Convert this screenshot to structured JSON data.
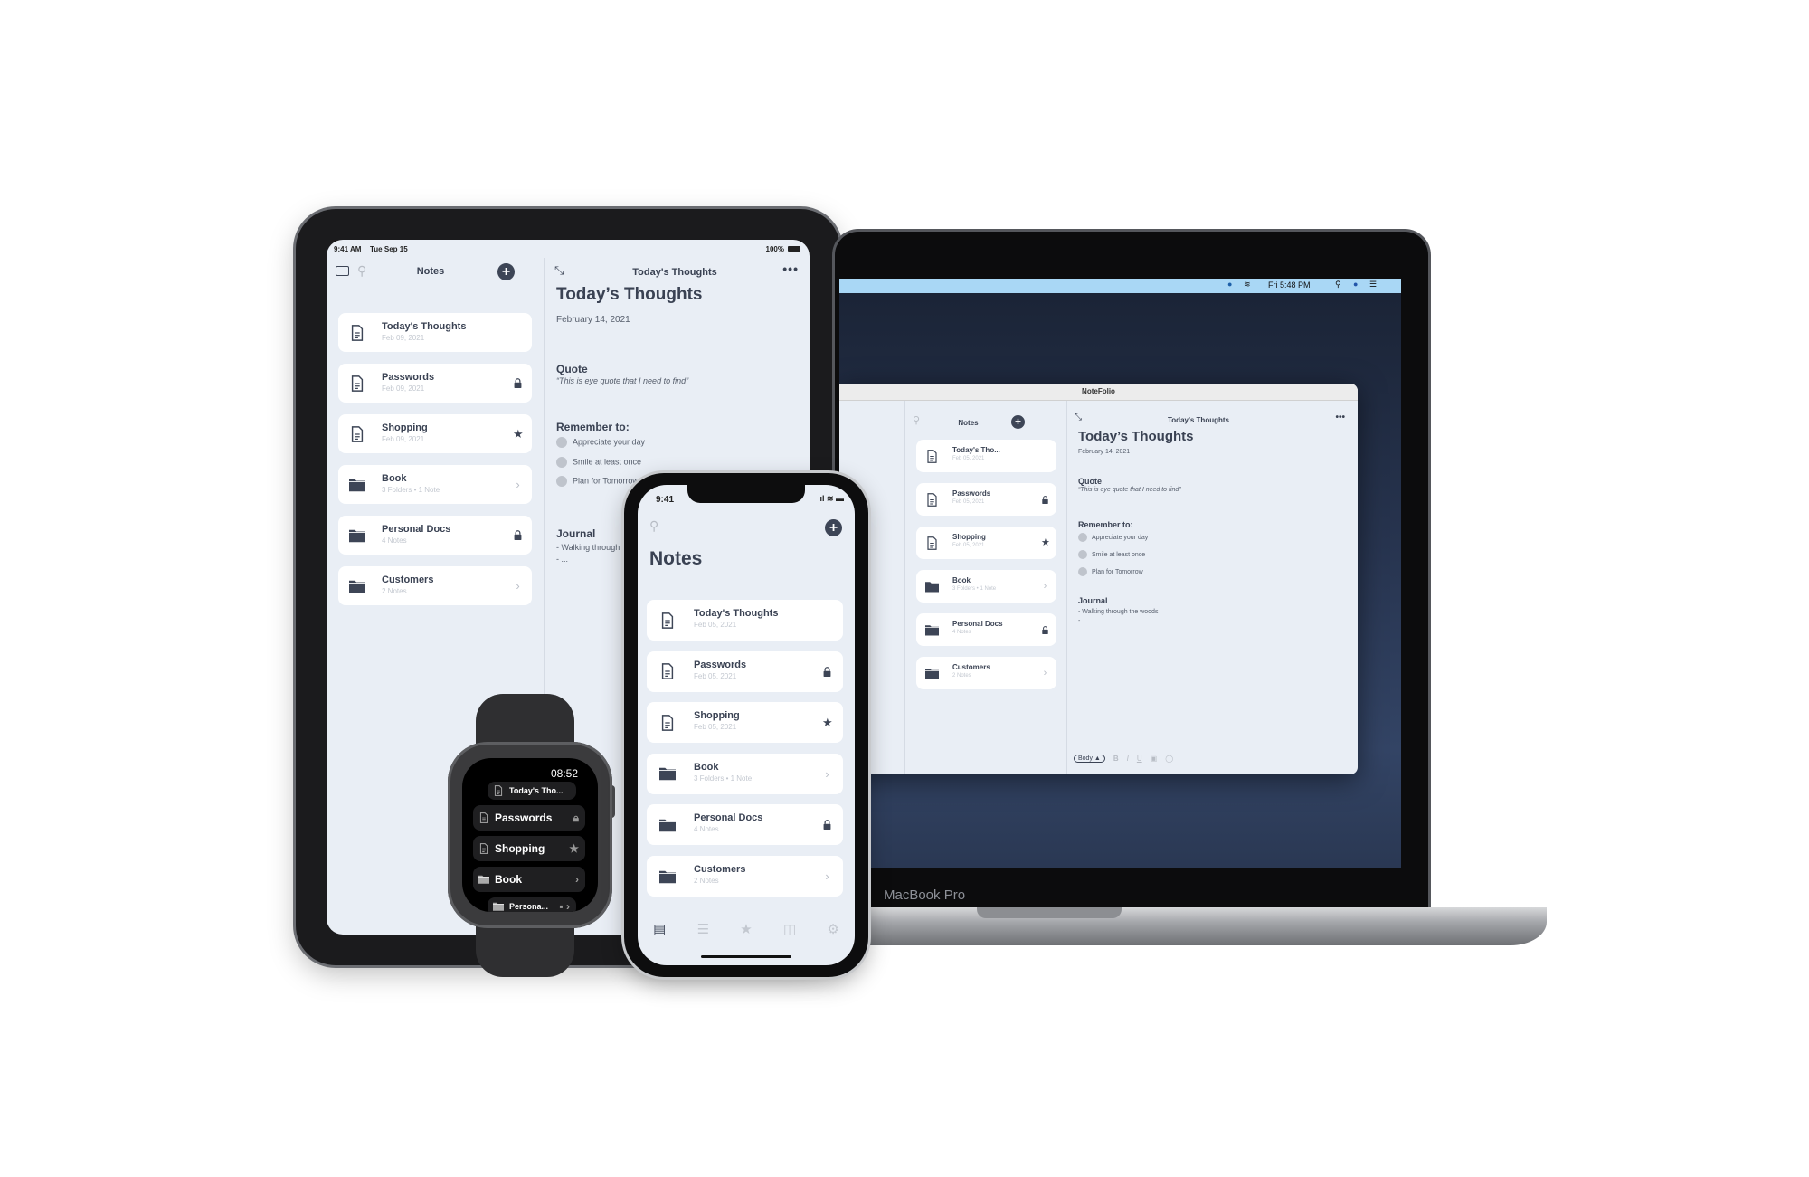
{
  "colors": {
    "app_bg": "#e9eef5",
    "card": "#ffffff",
    "text": "#3a4253",
    "icon": "#3d4556",
    "menubar": "#a9d7f5"
  },
  "ipad": {
    "status": {
      "time": "9:41 AM",
      "date": "Tue Sep 15",
      "battery": "100%"
    },
    "sidebar": {
      "title": "Notes",
      "items": [
        {
          "title": "Today's Thoughts",
          "subtitle": "Feb 09, 2021",
          "kind": "note",
          "accessory": ""
        },
        {
          "title": "Passwords",
          "subtitle": "Feb 09, 2021",
          "kind": "note",
          "accessory": "lock"
        },
        {
          "title": "Shopping",
          "subtitle": "Feb 09, 2021",
          "kind": "note",
          "accessory": "star"
        },
        {
          "title": "Book",
          "subtitle": "3 Folders • 1 Note",
          "kind": "folder",
          "accessory": "chevron"
        },
        {
          "title": "Personal Docs",
          "subtitle": "4 Notes",
          "kind": "folder",
          "accessory": "lock"
        },
        {
          "title": "Customers",
          "subtitle": "2 Notes",
          "kind": "folder",
          "accessory": "chevron"
        }
      ]
    },
    "detail": {
      "header": "Today's Thoughts",
      "title": "Today’s Thoughts",
      "date": "February 14, 2021",
      "quote_heading": "Quote",
      "quote": "“This is eye quote that I need to find”",
      "remember_heading": "Remember to:",
      "todos": [
        "Appreciate your day",
        "Smile at least once",
        "Plan for Tomorrow"
      ],
      "journal_heading": "Journal",
      "journal": [
        "- Walking through the woods",
        "- ..."
      ]
    }
  },
  "mac": {
    "menubar": {
      "clock": "Fri 5:48 PM"
    },
    "window_title": "NoteFolio",
    "label": "MacBook Pro",
    "list": {
      "title": "Notes",
      "items": [
        {
          "title": "Today's Tho...",
          "subtitle": "Feb 05, 2021",
          "kind": "note",
          "accessory": ""
        },
        {
          "title": "Passwords",
          "subtitle": "Feb 05, 2021",
          "kind": "note",
          "accessory": "lock"
        },
        {
          "title": "Shopping",
          "subtitle": "Feb 05, 2021",
          "kind": "note",
          "accessory": "star"
        },
        {
          "title": "Book",
          "subtitle": "3 Folders • 1 Note",
          "kind": "folder",
          "accessory": "chevron"
        },
        {
          "title": "Personal Docs",
          "subtitle": "4 Notes",
          "kind": "folder",
          "accessory": "lock"
        },
        {
          "title": "Customers",
          "subtitle": "2 Notes",
          "kind": "folder",
          "accessory": "chevron"
        }
      ]
    },
    "detail": {
      "header": "Today's Thoughts",
      "title": "Today’s Thoughts",
      "date": "February 14, 2021",
      "quote_heading": "Quote",
      "quote": "“This is eye quote that I need to find”",
      "remember_heading": "Remember to:",
      "todos": [
        "Appreciate your day",
        "Smile at least once",
        "Plan for Tomorrow"
      ],
      "journal_heading": "Journal",
      "journal": [
        "- Walking through the woods",
        "- ..."
      ]
    },
    "toolbar": {
      "style": "Body ▲",
      "bold": "B",
      "italic": "I",
      "underline": "U"
    }
  },
  "iphone": {
    "status": {
      "time": "9:41"
    },
    "title": "Notes",
    "items": [
      {
        "title": "Today's Thoughts",
        "subtitle": "Feb 05, 2021",
        "kind": "note",
        "accessory": ""
      },
      {
        "title": "Passwords",
        "subtitle": "Feb 05, 2021",
        "kind": "note",
        "accessory": "lock"
      },
      {
        "title": "Shopping",
        "subtitle": "Feb 05, 2021",
        "kind": "note",
        "accessory": "star"
      },
      {
        "title": "Book",
        "subtitle": "3 Folders • 1 Note",
        "kind": "folder",
        "accessory": "chevron"
      },
      {
        "title": "Personal Docs",
        "subtitle": "4 Notes",
        "kind": "folder",
        "accessory": "lock"
      },
      {
        "title": "Customers",
        "subtitle": "2 Notes",
        "kind": "folder",
        "accessory": "chevron"
      }
    ],
    "tabs": [
      "notebook-icon",
      "list-icon",
      "star-icon",
      "trash-icon",
      "gear-icon"
    ]
  },
  "watch": {
    "time": "08:52",
    "items": [
      {
        "title": "Today's Tho...",
        "kind": "note",
        "accessory": ""
      },
      {
        "title": "Passwords",
        "kind": "note",
        "accessory": "lock"
      },
      {
        "title": "Shopping",
        "kind": "note",
        "accessory": "star"
      },
      {
        "title": "Book",
        "kind": "folder",
        "accessory": "chevron"
      },
      {
        "title": "Persona...",
        "kind": "folder",
        "accessory": "lock-chevron"
      }
    ]
  }
}
